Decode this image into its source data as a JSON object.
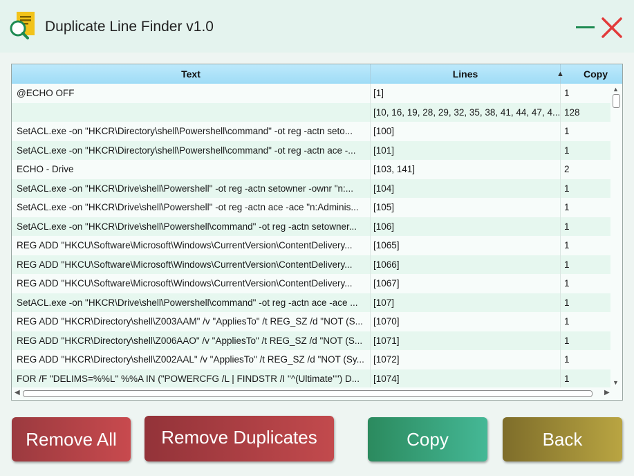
{
  "window": {
    "title": "Duplicate Line Finder v1.0",
    "minimize_color": "#1e8a52",
    "close_color": "#e23a3a"
  },
  "grid": {
    "columns": {
      "text": "Text",
      "lines": "Lines",
      "copy": "Copy"
    },
    "sort_indicator": "▲",
    "rows": [
      {
        "text": "@ECHO OFF",
        "lines": "[1]",
        "copy": "1"
      },
      {
        "text": "",
        "lines": "[10, 16, 19, 28, 29, 32, 35, 38, 41, 44, 47, 4...",
        "copy": "128"
      },
      {
        "text": "SetACL.exe -on \"HKCR\\Directory\\shell\\Powershell\\command\" -ot reg -actn seto...",
        "lines": "[100]",
        "copy": "1"
      },
      {
        "text": "SetACL.exe -on \"HKCR\\Directory\\shell\\Powershell\\command\" -ot reg -actn ace -...",
        "lines": "[101]",
        "copy": "1"
      },
      {
        "text": "ECHO             - Drive",
        "lines": "[103, 141]",
        "copy": "2"
      },
      {
        "text": "SetACL.exe -on \"HKCR\\Drive\\shell\\Powershell\" -ot reg -actn setowner -ownr \"n:...",
        "lines": "[104]",
        "copy": "1"
      },
      {
        "text": "SetACL.exe -on \"HKCR\\Drive\\shell\\Powershell\" -ot reg -actn ace -ace \"n:Adminis...",
        "lines": "[105]",
        "copy": "1"
      },
      {
        "text": "SetACL.exe -on \"HKCR\\Drive\\shell\\Powershell\\command\" -ot reg -actn setowner...",
        "lines": "[106]",
        "copy": "1"
      },
      {
        "text": "REG ADD \"HKCU\\Software\\Microsoft\\Windows\\CurrentVersion\\ContentDelivery...",
        "lines": "[1065]",
        "copy": "1"
      },
      {
        "text": "REG ADD \"HKCU\\Software\\Microsoft\\Windows\\CurrentVersion\\ContentDelivery...",
        "lines": "[1066]",
        "copy": "1"
      },
      {
        "text": "REG ADD \"HKCU\\Software\\Microsoft\\Windows\\CurrentVersion\\ContentDelivery...",
        "lines": "[1067]",
        "copy": "1"
      },
      {
        "text": "SetACL.exe -on \"HKCR\\Drive\\shell\\Powershell\\command\" -ot reg -actn ace -ace ...",
        "lines": "[107]",
        "copy": "1"
      },
      {
        "text": "REG ADD \"HKCR\\Directory\\shell\\Z003AAM\" /v \"AppliesTo\" /t REG_SZ /d \"NOT (S...",
        "lines": "[1070]",
        "copy": "1"
      },
      {
        "text": "REG ADD \"HKCR\\Directory\\shell\\Z006AAO\" /v \"AppliesTo\" /t REG_SZ /d \"NOT (S...",
        "lines": "[1071]",
        "copy": "1"
      },
      {
        "text": "REG ADD \"HKCR\\Directory\\shell\\Z002AAL\" /v \"AppliesTo\" /t REG_SZ /d \"NOT (Sy...",
        "lines": "[1072]",
        "copy": "1"
      },
      {
        "text": "FOR /F \"DELIMS=%%L\" %%A IN (\"POWERCFG /L | FINDSTR /I \"^(Ultimate\"\") D...",
        "lines": "[1074]",
        "copy": "1"
      }
    ]
  },
  "buttons": {
    "remove_all": "Remove All",
    "remove_duplicates": "Remove Duplicates",
    "copy": "Copy",
    "back": "Back"
  },
  "icons": {
    "app": "document-magnifier-icon",
    "minimize": "minimize-icon",
    "close": "close-icon",
    "sort": "sort-ascending-icon"
  }
}
